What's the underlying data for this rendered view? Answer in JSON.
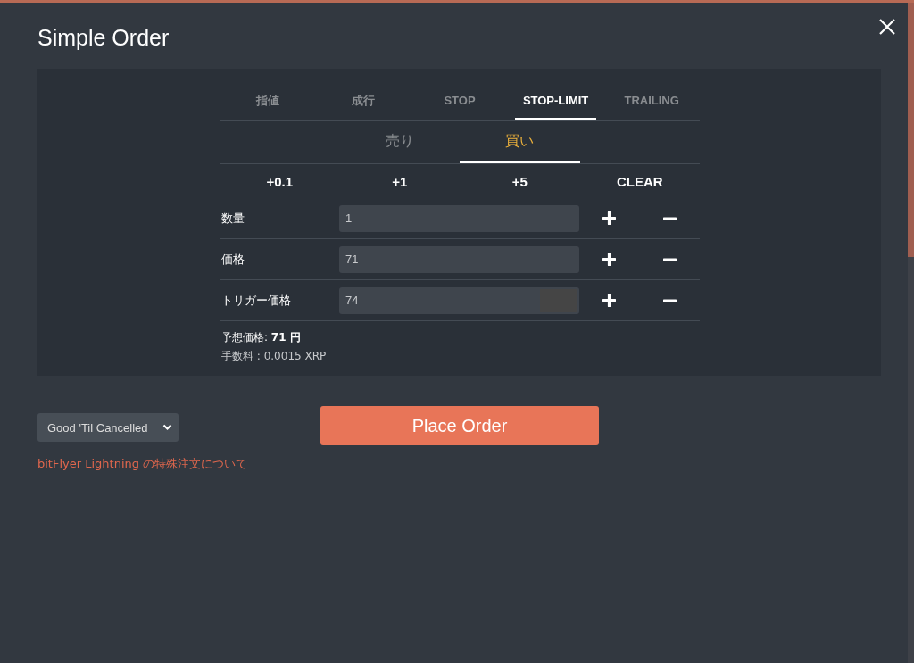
{
  "title": "Simple Order",
  "order_types": [
    {
      "label": "指値",
      "selected": false
    },
    {
      "label": "成行",
      "selected": false
    },
    {
      "label": "STOP",
      "selected": false
    },
    {
      "label": "STOP-LIMIT",
      "selected": true
    },
    {
      "label": "TRAILING",
      "selected": false
    }
  ],
  "sides": [
    {
      "label": "売り",
      "selected": false
    },
    {
      "label": "買い",
      "selected": true
    }
  ],
  "steps": [
    "+0.1",
    "+1",
    "+5",
    "CLEAR"
  ],
  "fields": [
    {
      "label": "数量",
      "value": "1"
    },
    {
      "label": "価格",
      "value": "71"
    },
    {
      "label": "トリガー価格",
      "value": "74",
      "addon": true
    }
  ],
  "estimate": "予想価格: **71  円**",
  "fee": "手数料 : 0.0015 XRP",
  "time_in_force": {
    "value": "Good 'Til Cancelled"
  },
  "place_order": "Place Order",
  "link": "bitFlyer Lightning の特殊注文について"
}
